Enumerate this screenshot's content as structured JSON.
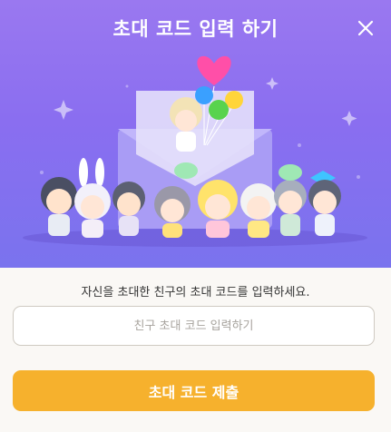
{
  "dialog": {
    "title": "초대 코드 입력 하기"
  },
  "form": {
    "instruction": "자신을 초대한 친구의 초대 코드를 입력하세요.",
    "input_placeholder": "친구 초대 코드 입력하기",
    "input_value": "",
    "submit_label": "초대 코드 제출"
  },
  "colors": {
    "accent": "#f6b12d",
    "hero_background": "#8a6ef0"
  },
  "icons": {
    "close": "close-icon",
    "balloons": "balloon-icon",
    "envelope": "envelope-icon"
  }
}
